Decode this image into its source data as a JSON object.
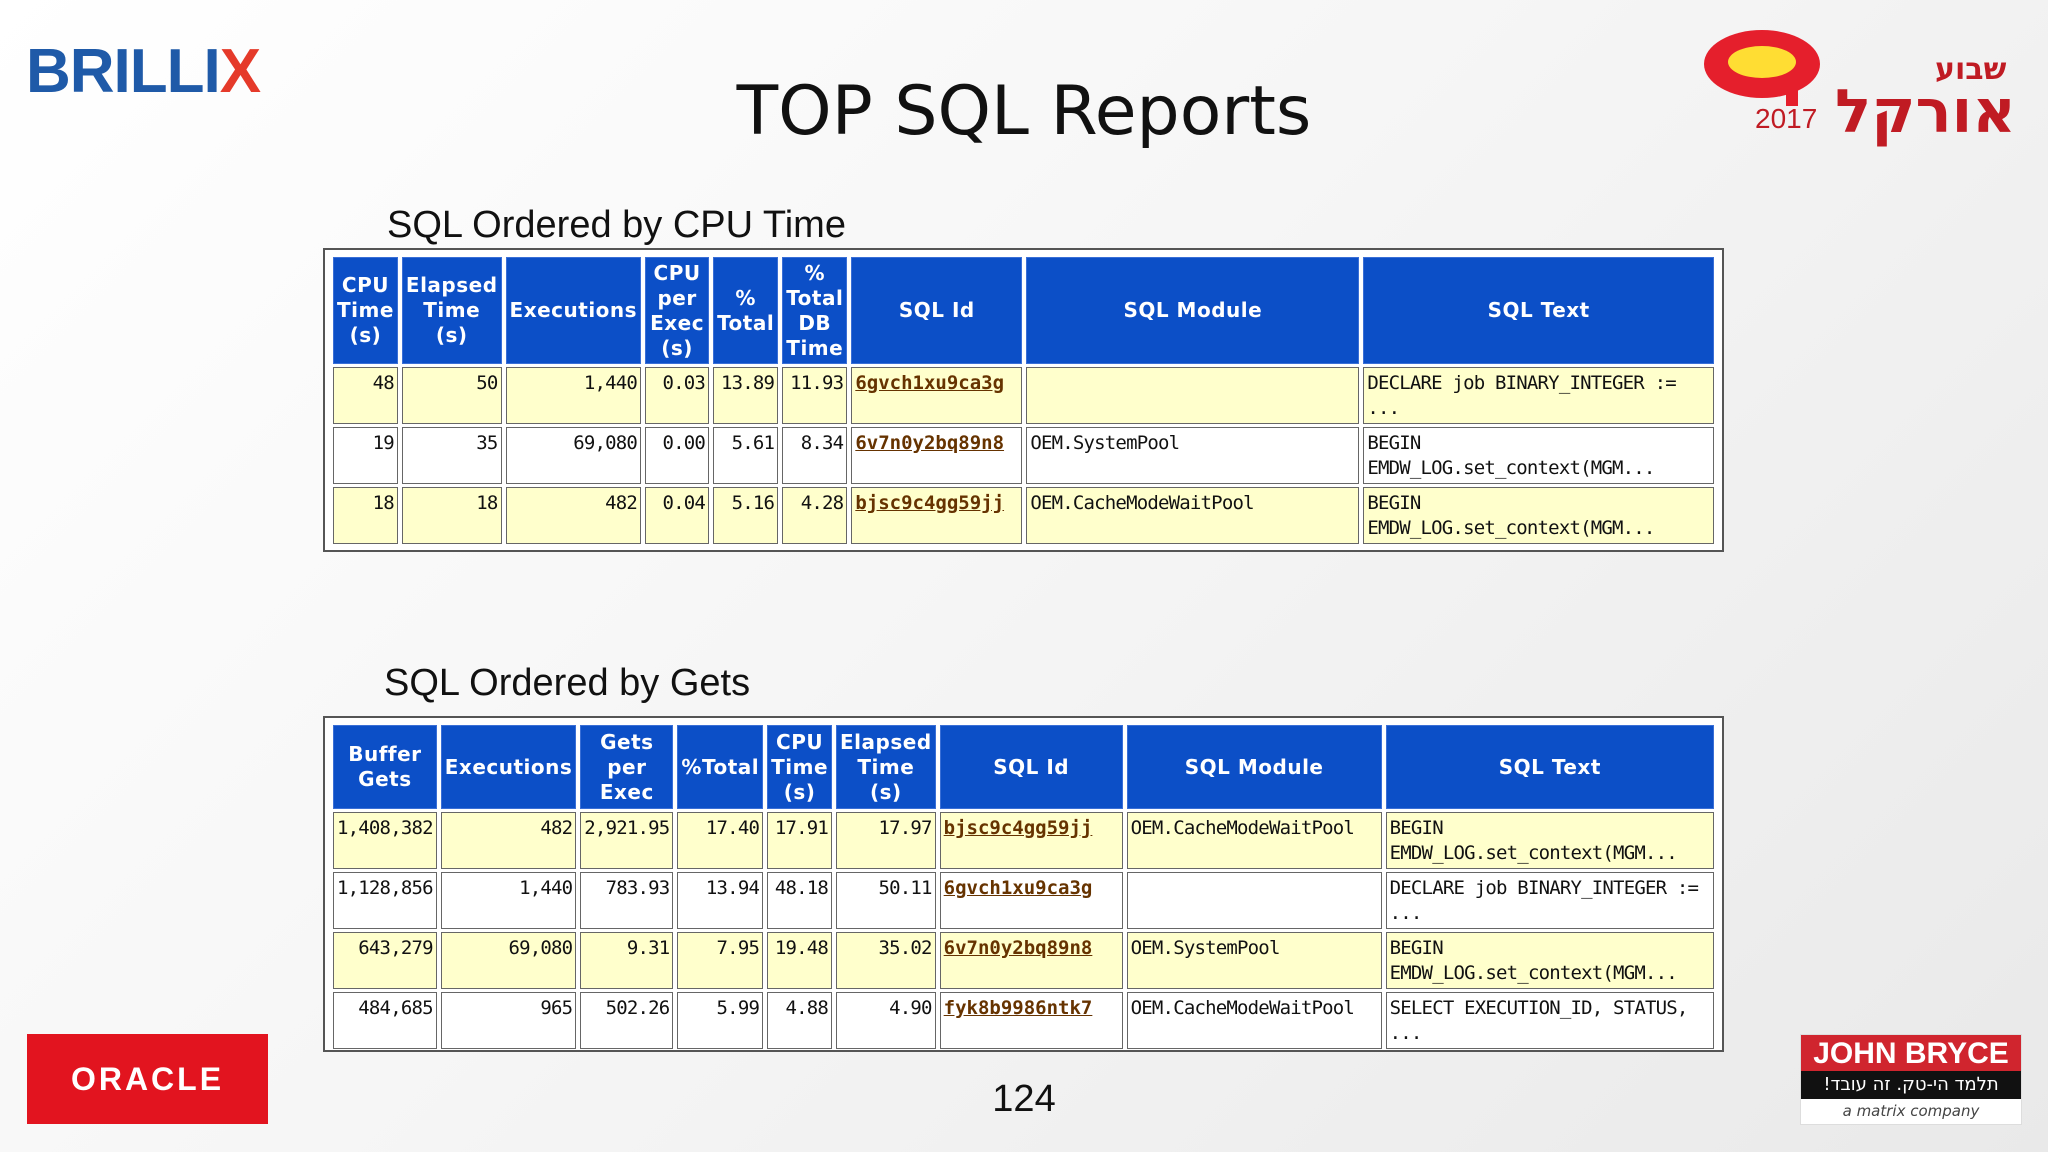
{
  "header": {
    "brand_left": "BRILLI",
    "brand_left_x": "X",
    "title": "TOP SQL Reports",
    "event_hebrew_top": "שבוע",
    "event_hebrew_main": "אורקל",
    "event_year": "2017"
  },
  "cpu_section": {
    "title": "SQL Ordered by CPU Time",
    "headers": [
      "CPU Time (s)",
      "Elapsed Time (s)",
      "Executions",
      "CPU per Exec (s)",
      "% Total",
      "% Total DB Time",
      "SQL Id",
      "SQL Module",
      "SQL Text"
    ],
    "rows": [
      {
        "cpu_time": "48",
        "elapsed": "50",
        "executions": "1,440",
        "cpu_per_exec": "0.03",
        "pct_total": "13.89",
        "pct_db_time": "11.93",
        "sql_id": "6gvch1xu9ca3g",
        "module": "",
        "text": "DECLARE job BINARY_INTEGER :=\n..."
      },
      {
        "cpu_time": "19",
        "elapsed": "35",
        "executions": "69,080",
        "cpu_per_exec": "0.00",
        "pct_total": "5.61",
        "pct_db_time": "8.34",
        "sql_id": "6v7n0y2bq89n8",
        "module": "OEM.SystemPool",
        "text": "BEGIN\nEMDW_LOG.set_context(MGM..."
      },
      {
        "cpu_time": "18",
        "elapsed": "18",
        "executions": "482",
        "cpu_per_exec": "0.04",
        "pct_total": "5.16",
        "pct_db_time": "4.28",
        "sql_id": "bjsc9c4gg59jj",
        "module": "OEM.CacheModeWaitPool",
        "text": "BEGIN\nEMDW_LOG.set_context(MGM..."
      }
    ]
  },
  "gets_section": {
    "title": "SQL Ordered by Gets",
    "headers": [
      "Buffer Gets",
      "Executions",
      "Gets per Exec",
      "%Total",
      "CPU Time (s)",
      "Elapsed Time (s)",
      "SQL Id",
      "SQL Module",
      "SQL Text"
    ],
    "rows": [
      {
        "buffer_gets": "1,408,382",
        "executions": "482",
        "gets_per_exec": "2,921.95",
        "pct_total": "17.40",
        "cpu_time": "17.91",
        "elapsed": "17.97",
        "sql_id": "bjsc9c4gg59jj",
        "module": "OEM.CacheModeWaitPool",
        "text": "BEGIN\nEMDW_LOG.set_context(MGM..."
      },
      {
        "buffer_gets": "1,128,856",
        "executions": "1,440",
        "gets_per_exec": "783.93",
        "pct_total": "13.94",
        "cpu_time": "48.18",
        "elapsed": "50.11",
        "sql_id": "6gvch1xu9ca3g",
        "module": "",
        "text": "DECLARE job BINARY_INTEGER :=\n..."
      },
      {
        "buffer_gets": "643,279",
        "executions": "69,080",
        "gets_per_exec": "9.31",
        "pct_total": "7.95",
        "cpu_time": "19.48",
        "elapsed": "35.02",
        "sql_id": "6v7n0y2bq89n8",
        "module": "OEM.SystemPool",
        "text": "BEGIN\nEMDW_LOG.set_context(MGM..."
      },
      {
        "buffer_gets": "484,685",
        "executions": "965",
        "gets_per_exec": "502.26",
        "pct_total": "5.99",
        "cpu_time": "4.88",
        "elapsed": "4.90",
        "sql_id": "fyk8b9986ntk7",
        "module": "OEM.CacheModeWaitPool",
        "text": "SELECT EXECUTION_ID, STATUS,\n..."
      }
    ]
  },
  "footer": {
    "page_number": "124",
    "oracle_logo": "ORACLE",
    "jb_name": "JOHN BRYCE",
    "jb_tagline": "תלמד הי-טק. זה עובד!",
    "jb_company": "a matrix company"
  },
  "colors": {
    "header_blue": "#0c4fc7",
    "row_yellow": "#ffffcc",
    "link_brown": "#663300",
    "oracle_red": "#e2141f",
    "brillix_blue": "#1f5aa8",
    "brillix_red": "#e53a2a"
  }
}
